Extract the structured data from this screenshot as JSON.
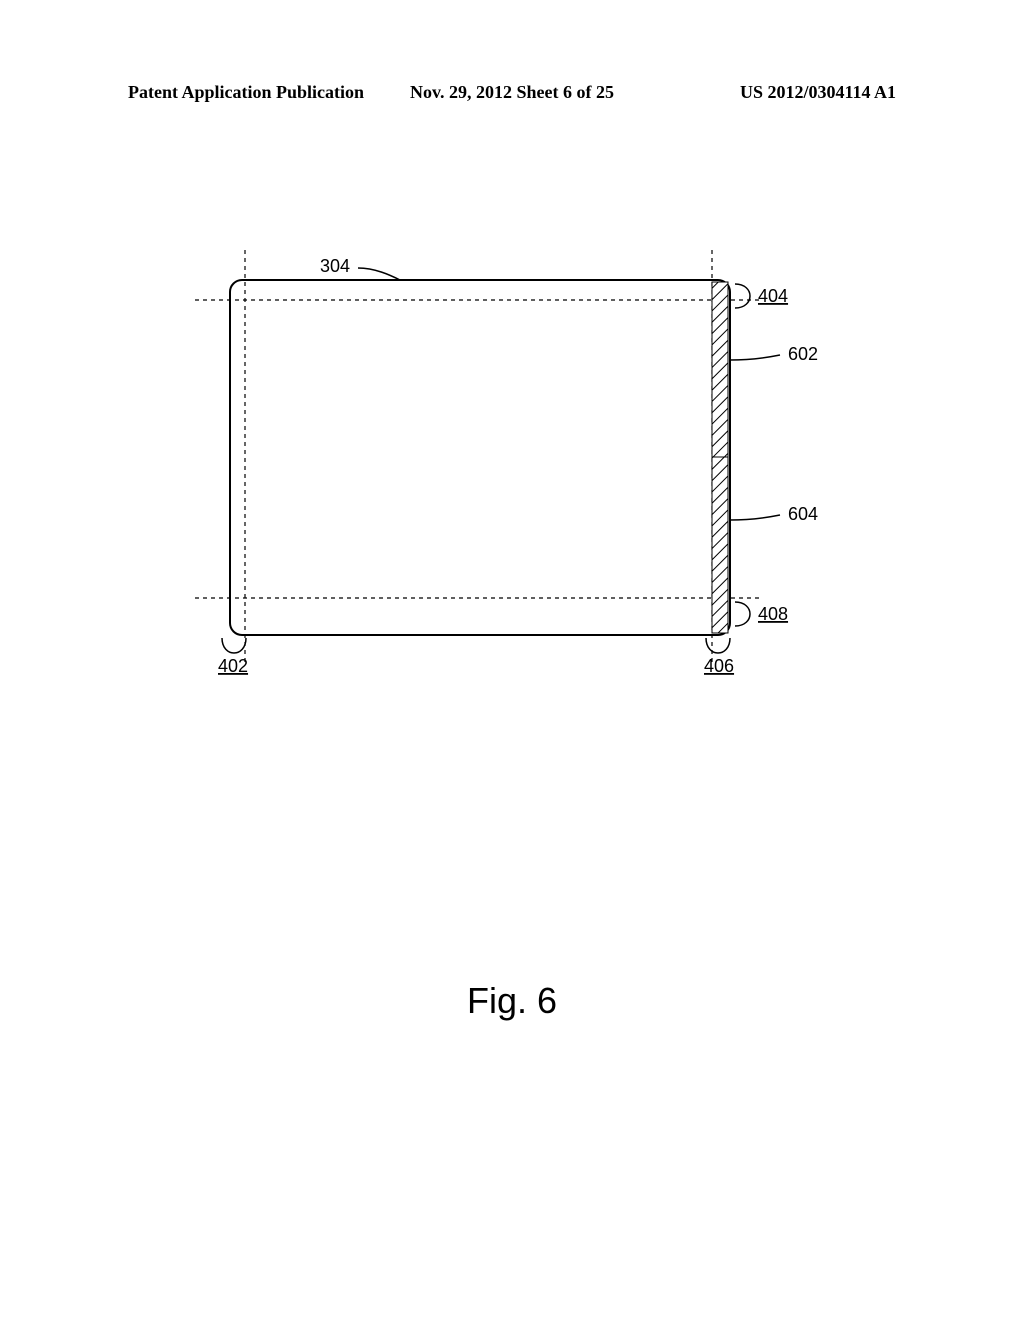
{
  "header": {
    "left": "Patent Application Publication",
    "center": "Nov. 29, 2012  Sheet 6 of 25",
    "right": "US 2012/0304114 A1"
  },
  "figure": {
    "caption": "Fig. 6",
    "refs": {
      "r304": "304",
      "r402": "402",
      "r404": "404",
      "r406": "406",
      "r408": "408",
      "r602": "602",
      "r604": "604"
    }
  }
}
